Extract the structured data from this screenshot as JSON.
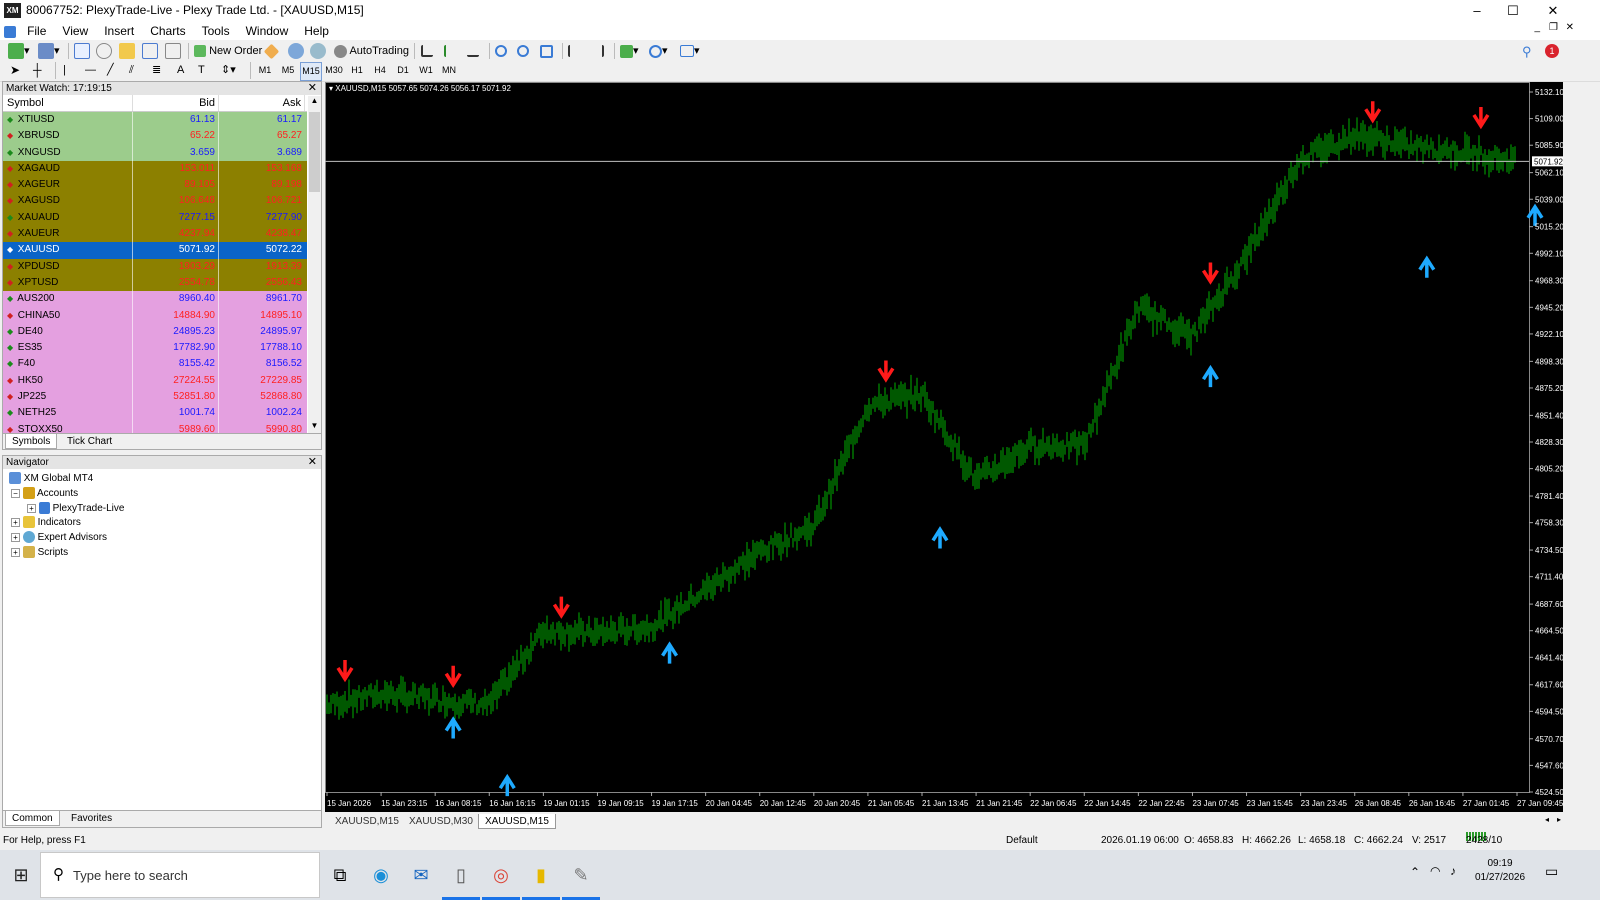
{
  "window": {
    "title": "80067752: PlexyTrade-Live - Plexy Trade Ltd. - [XAUUSD,M15]",
    "logo": "XM",
    "minimize": "–",
    "maximize": "☐",
    "close": "✕"
  },
  "menu": [
    "File",
    "View",
    "Insert",
    "Charts",
    "Tools",
    "Window",
    "Help"
  ],
  "toolbar": {
    "new_order": "New Order",
    "autotrading": "AutoTrading",
    "notification_count": "1",
    "timeframes": [
      "M1",
      "M5",
      "M15",
      "M30",
      "H1",
      "H4",
      "D1",
      "W1",
      "MN"
    ],
    "active_timeframe": "M15",
    "draw_text_tool": "A"
  },
  "market_watch": {
    "title": "Market Watch: 17:19:15",
    "columns": {
      "symbol": "Symbol",
      "bid": "Bid",
      "ask": "Ask"
    },
    "rows": [
      {
        "symbol": "XTIUSD",
        "bid": "61.13",
        "ask": "61.17",
        "bg": "#9ccc8c",
        "bidc": "#1a1aff",
        "askc": "#1a1aff",
        "dir": "up"
      },
      {
        "symbol": "XBRUSD",
        "bid": "65.22",
        "ask": "65.27",
        "bg": "#9ccc8c",
        "bidc": "#ff2020",
        "askc": "#ff2020",
        "dir": "down"
      },
      {
        "symbol": "XNGUSD",
        "bid": "3.659",
        "ask": "3.689",
        "bg": "#9ccc8c",
        "bidc": "#1a1aff",
        "askc": "#1a1aff",
        "dir": "up"
      },
      {
        "symbol": "XAGAUD",
        "bid": "153.011",
        "ask": "153.168",
        "bg": "#8c8000",
        "bidc": "#ff2020",
        "askc": "#ff2020",
        "dir": "down"
      },
      {
        "symbol": "XAGEUR",
        "bid": "89.105",
        "ask": "89.198",
        "bg": "#8c8000",
        "bidc": "#ff2020",
        "askc": "#ff2020",
        "dir": "down"
      },
      {
        "symbol": "XAGUSD",
        "bid": "106.648",
        "ask": "106.721",
        "bg": "#8c8000",
        "bidc": "#ff2020",
        "askc": "#ff2020",
        "dir": "down"
      },
      {
        "symbol": "XAUAUD",
        "bid": "7277.15",
        "ask": "7277.90",
        "bg": "#8c8000",
        "bidc": "#1a1aff",
        "askc": "#1a1aff",
        "dir": "up"
      },
      {
        "symbol": "XAUEUR",
        "bid": "4237.94",
        "ask": "4238.47",
        "bg": "#8c8000",
        "bidc": "#ff2020",
        "askc": "#ff2020",
        "dir": "down"
      },
      {
        "symbol": "XAUUSD",
        "bid": "5071.92",
        "ask": "5072.22",
        "bg": "#0a64c8",
        "bidc": "#ffffff",
        "askc": "#ffffff",
        "dir": "down",
        "sel": true
      },
      {
        "symbol": "XPDUSD",
        "bid": "1903.29",
        "ask": "1913.39",
        "bg": "#8c8000",
        "bidc": "#ff2020",
        "askc": "#ff2020",
        "dir": "down"
      },
      {
        "symbol": "XPTUSD",
        "bid": "2554.78",
        "ask": "2556.43",
        "bg": "#8c8000",
        "bidc": "#ff2020",
        "askc": "#ff2020",
        "dir": "down"
      },
      {
        "symbol": "AUS200",
        "bid": "8960.40",
        "ask": "8961.70",
        "bg": "#e4a0e0",
        "bidc": "#1a1aff",
        "askc": "#1a1aff",
        "dir": "up"
      },
      {
        "symbol": "CHINA50",
        "bid": "14884.90",
        "ask": "14895.10",
        "bg": "#e4a0e0",
        "bidc": "#ff2020",
        "askc": "#ff2020",
        "dir": "down"
      },
      {
        "symbol": "DE40",
        "bid": "24895.23",
        "ask": "24895.97",
        "bg": "#e4a0e0",
        "bidc": "#1a1aff",
        "askc": "#1a1aff",
        "dir": "up"
      },
      {
        "symbol": "ES35",
        "bid": "17782.90",
        "ask": "17788.10",
        "bg": "#e4a0e0",
        "bidc": "#1a1aff",
        "askc": "#1a1aff",
        "dir": "up"
      },
      {
        "symbol": "F40",
        "bid": "8155.42",
        "ask": "8156.52",
        "bg": "#e4a0e0",
        "bidc": "#1a1aff",
        "askc": "#1a1aff",
        "dir": "up"
      },
      {
        "symbol": "HK50",
        "bid": "27224.55",
        "ask": "27229.85",
        "bg": "#e4a0e0",
        "bidc": "#ff2020",
        "askc": "#ff2020",
        "dir": "down"
      },
      {
        "symbol": "JP225",
        "bid": "52851.80",
        "ask": "52868.80",
        "bg": "#e4a0e0",
        "bidc": "#ff2020",
        "askc": "#ff2020",
        "dir": "down"
      },
      {
        "symbol": "NETH25",
        "bid": "1001.74",
        "ask": "1002.24",
        "bg": "#e4a0e0",
        "bidc": "#1a1aff",
        "askc": "#1a1aff",
        "dir": "up"
      },
      {
        "symbol": "STOXX50",
        "bid": "5989.60",
        "ask": "5990.80",
        "bg": "#e4a0e0",
        "bidc": "#ff2020",
        "askc": "#ff2020",
        "dir": "down"
      }
    ],
    "tabs": [
      "Symbols",
      "Tick Chart"
    ]
  },
  "navigator": {
    "title": "Navigator",
    "root": "XM Global MT4",
    "accounts": "Accounts",
    "account": "PlexyTrade-Live",
    "indicators": "Indicators",
    "experts": "Expert Advisors",
    "scripts": "Scripts",
    "tabs": [
      "Common",
      "Favorites"
    ]
  },
  "chart": {
    "header": "XAUUSD,M15  5057.65 5074.26 5056.17 5071.92",
    "current_price_label": "5071.92",
    "price_labels": [
      "5132.10",
      "5109.00",
      "5085.90",
      "5062.10",
      "5039.00",
      "5015.20",
      "4992.10",
      "4968.30",
      "4945.20",
      "4922.10",
      "4898.30",
      "4875.20",
      "4851.40",
      "4828.30",
      "4805.20",
      "4781.40",
      "4758.30",
      "4734.50",
      "4711.40",
      "4687.60",
      "4664.50",
      "4641.40",
      "4617.60",
      "4594.50",
      "4570.70",
      "4547.60",
      "4524.50"
    ],
    "time_labels": [
      "15 Jan 2026",
      "15 Jan 23:15",
      "16 Jan 08:15",
      "16 Jan 16:15",
      "19 Jan 01:15",
      "19 Jan 09:15",
      "19 Jan 17:15",
      "20 Jan 04:45",
      "20 Jan 12:45",
      "20 Jan 20:45",
      "21 Jan 05:45",
      "21 Jan 13:45",
      "21 Jan 21:45",
      "22 Jan 06:45",
      "22 Jan 14:45",
      "22 Jan 22:45",
      "23 Jan 07:45",
      "23 Jan 15:45",
      "23 Jan 23:45",
      "26 Jan 08:45",
      "26 Jan 16:45",
      "27 Jan 01:45",
      "27 Jan 09:45"
    ],
    "bar_color": "#00b000",
    "sell_arrow_color": "#ff1a1a",
    "buy_arrow_color": "#1eaaff"
  },
  "chart_data": {
    "type": "line",
    "title": "XAUUSD,M15",
    "y_range": [
      4524.5,
      5132.1
    ],
    "x": [
      "15 Jan 2026",
      "15 Jan 23:15",
      "16 Jan 08:15",
      "16 Jan 16:15",
      "19 Jan 01:15",
      "19 Jan 09:15",
      "19 Jan 17:15",
      "20 Jan 04:45",
      "20 Jan 12:45",
      "20 Jan 20:45",
      "21 Jan 05:45",
      "21 Jan 13:45",
      "21 Jan 21:45",
      "22 Jan 06:45",
      "22 Jan 14:45",
      "22 Jan 22:45",
      "23 Jan 07:45",
      "23 Jan 15:45",
      "23 Jan 23:45",
      "26 Jan 08:45",
      "26 Jan 16:45",
      "27 Jan 01:45",
      "27 Jan 09:45"
    ],
    "series": [
      {
        "values": [
          4600,
          4610,
          4605,
          4600,
          4665,
          4662,
          4668,
          4700,
          4733,
          4755,
          4860,
          4870,
          4795,
          4825,
          4825,
          4945,
          4920,
          4990,
          5075,
          5095,
          5085,
          5080,
          5072
        ]
      }
    ],
    "sell_signals": [
      {
        "x": "15 Jan 2026",
        "y": 4620
      },
      {
        "x": "16 Jan 08:15",
        "y": 4615
      },
      {
        "x": "19 Jan 01:15",
        "y": 4675
      },
      {
        "x": "21 Jan 05:45",
        "y": 4880
      },
      {
        "x": "23 Jan 07:45",
        "y": 4965
      },
      {
        "x": "26 Jan 08:45",
        "y": 5105
      },
      {
        "x": "27 Jan 01:45",
        "y": 5100
      }
    ],
    "buy_signals": [
      {
        "x": "16 Jan 08:15",
        "y": 4590
      },
      {
        "x": "16 Jan 16:15",
        "y": 4540
      },
      {
        "x": "19 Jan 17:15",
        "y": 4655
      },
      {
        "x": "21 Jan 13:45",
        "y": 4755
      },
      {
        "x": "23 Jan 07:45",
        "y": 4895
      },
      {
        "x": "26 Jan 16:45",
        "y": 4990
      },
      {
        "x": "27 Jan 09:45",
        "y": 5035
      }
    ]
  },
  "chart_tabs": [
    "XAUUSD,M15",
    "XAUUSD,M30",
    "XAUUSD,M15"
  ],
  "status": {
    "help": "For Help, press F1",
    "profile": "Default",
    "datetime": "2026.01.19 06:00",
    "open": "O: 4658.83",
    "high": "H: 4662.26",
    "low": "L: 4658.18",
    "close": "C: 4662.24",
    "volume": "V: 2517",
    "traffic": "2428/10 kb"
  },
  "taskbar": {
    "search_placeholder": "Type here to search",
    "time": "09:19",
    "date": "01/27/2026"
  }
}
